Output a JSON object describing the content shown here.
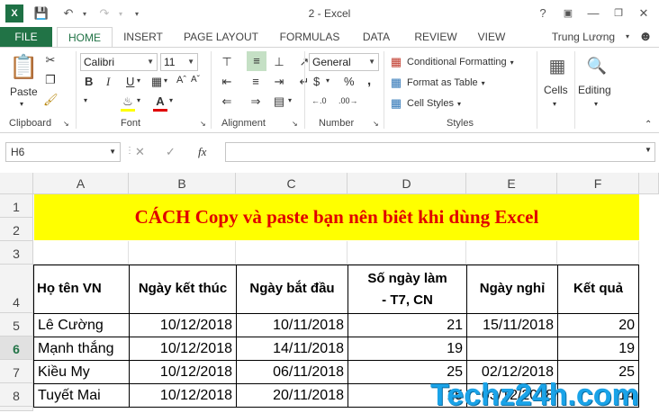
{
  "window": {
    "title": "2 - Excel",
    "user": "Trung Lương"
  },
  "qat": {
    "logo": "X"
  },
  "tabs": [
    "FILE",
    "HOME",
    "INSERT",
    "PAGE LAYOUT",
    "FORMULAS",
    "DATA",
    "REVIEW",
    "VIEW"
  ],
  "ribbon": {
    "clipboard": {
      "label": "Clipboard",
      "paste": "Paste"
    },
    "font": {
      "label": "Font",
      "name": "Calibri",
      "size": "11",
      "bold": "B",
      "italic": "I",
      "underline": "U"
    },
    "alignment": {
      "label": "Alignment"
    },
    "number": {
      "label": "Number",
      "format": "General",
      "currency": "$",
      "percent": "%",
      "comma": ","
    },
    "styles": {
      "label": "Styles",
      "conditional": "Conditional Formatting",
      "format_table": "Format as Table",
      "cell_styles": "Cell Styles"
    },
    "cells": {
      "label": "Cells"
    },
    "editing": {
      "label": "Editing"
    }
  },
  "formula_bar": {
    "name_box": "H6",
    "fx": "fx",
    "value": ""
  },
  "columns": [
    "A",
    "B",
    "C",
    "D",
    "E",
    "F"
  ],
  "rows": [
    "1",
    "2",
    "3",
    "4",
    "5",
    "6",
    "7",
    "8"
  ],
  "banner": "CÁCH Copy và paste bạn nên biêt khi dùng Excel",
  "table": {
    "headers": [
      "Họ tên VN",
      "Ngày kết thúc",
      "Ngày bắt đầu",
      "Số ngày làm - T7, CN",
      "Ngày nghỉ",
      "Kết quả"
    ],
    "rows": [
      [
        "Lê Cường",
        "10/12/2018",
        "10/11/2018",
        "21",
        "15/11/2018",
        "20"
      ],
      [
        "Mạnh thắng",
        "10/12/2018",
        "14/11/2018",
        "19",
        "",
        "19"
      ],
      [
        "Kiều My",
        "10/12/2018",
        "06/11/2018",
        "25",
        "02/12/2018",
        "25"
      ],
      [
        "Tuyết Mai",
        "10/12/2018",
        "20/11/2018",
        "15",
        "03/12/2018",
        "14"
      ]
    ]
  },
  "watermark": "Techz24h.com",
  "colors": {
    "excel_green": "#217346",
    "banner_bg": "#ffff00",
    "banner_text": "#e00000",
    "watermark": "#1aa3e8"
  }
}
